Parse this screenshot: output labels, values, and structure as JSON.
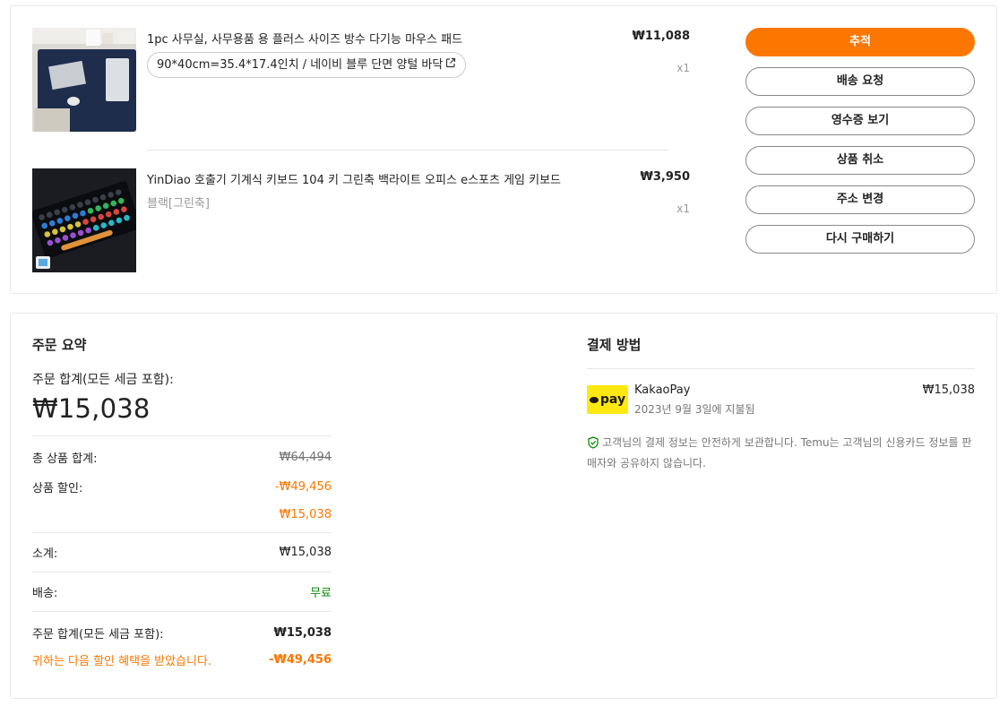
{
  "items": [
    {
      "title": "1pc 사무실, 사무용품 용 플러스 사이즈 방수 다기능 마우스 패드",
      "variant": "90*40cm=35.4*17.4인치 / 네이비 블루 단면 양털 바닥",
      "price": "₩11,088",
      "qty": "x1"
    },
    {
      "title": "YinDiao 호출기 기계식 키보드 104 키 그린축 백라이트 오피스 e스포츠 게임 키보드",
      "variant": "블랙[그린축]",
      "price": "₩3,950",
      "qty": "x1"
    }
  ],
  "actions": [
    "추적",
    "배송 요청",
    "영수증 보기",
    "상품 취소",
    "주소 변경",
    "다시 구매하기"
  ],
  "summary": {
    "title": "주문 요약",
    "total_label": "주문 합계(모든 세금 포함):",
    "total_value": "₩15,038",
    "item_total_label": "총 상품 합계:",
    "item_total_value": "₩64,494",
    "discount_label": "상품 할인:",
    "discount_value": "-₩49,456",
    "discounted_value": "₩15,038",
    "subtotal_label": "소계:",
    "subtotal_value": "₩15,038",
    "shipping_label": "배송:",
    "shipping_value": "무료",
    "order_total_label": "주문 합계(모든 세금 포함):",
    "order_total_value": "₩15,038",
    "savings_label": "귀하는 다음 할인 혜택을 받았습니다.",
    "savings_value": "-₩49,456"
  },
  "payment": {
    "title": "결제 방법",
    "logo_text": "pay",
    "method": "KakaoPay",
    "date": "2023년 9월 3일에 지불됨",
    "amount": "₩15,038",
    "secure_note": "고객님의 결제 정보는 안전하게 보관합니다. Temu는 고객님의 신용카드 정보를 판매자와 공유하지 않습니다."
  },
  "colors": {
    "accent": "#fb7701",
    "free_shipping": "#0a8800",
    "kakao_yellow": "#ffe812",
    "shield_green": "#0a8800"
  }
}
